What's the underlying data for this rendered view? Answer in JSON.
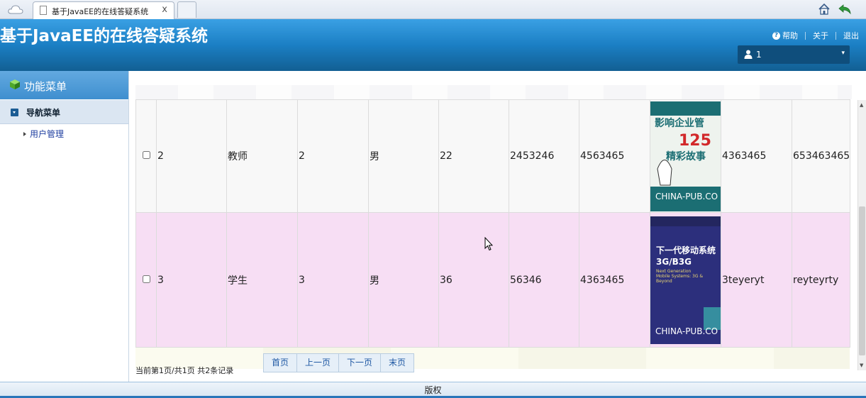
{
  "browser": {
    "tab_title": "基于JavaEE的在线答疑系统",
    "tab_close": "x"
  },
  "header": {
    "app_title": "基于JavaEE的在线答疑系统",
    "help_label": "帮助",
    "about_label": "关于",
    "logout_label": "退出",
    "user_name": "1",
    "user_caret": "▾"
  },
  "sidebar": {
    "menu_title": "功能菜单",
    "nav_title": "导航菜单",
    "items": [
      {
        "label": "用户管理"
      }
    ]
  },
  "table": {
    "rows": [
      {
        "id": "2",
        "role": "教师",
        "c3": "2",
        "gender": "男",
        "age": "22",
        "c6": "2453246",
        "c7": "4563465",
        "c9": "4363465",
        "c10": "653463465",
        "book": {
          "title_line1": "影响企业管",
          "title_num": "125",
          "title_line2": "精彩故事",
          "publisher": "CHINA-PUB.CO",
          "bg": "#1a6f74"
        }
      },
      {
        "id": "3",
        "role": "学生",
        "c3": "3",
        "gender": "男",
        "age": "36",
        "c6": "56346",
        "c7": "4363465",
        "c9": "3teyeryt",
        "c10": "reyteyrty",
        "book": {
          "title_line1": "下一代移动系统",
          "title_line2": "3G/B3G",
          "subtitle": "Next Generation Mobile Systems: 3G & Beyond",
          "publisher": "CHINA-PUB.CO",
          "bg": "#2c2f7c"
        }
      }
    ]
  },
  "pager": {
    "status": "当前第1页/共1页  共2条记录",
    "first": "首页",
    "prev": "上一页",
    "next": "下一页",
    "last": "末页"
  },
  "footer": {
    "text": "版权"
  }
}
